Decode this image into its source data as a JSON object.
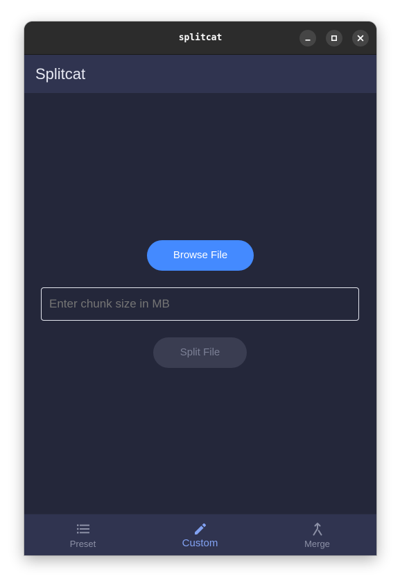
{
  "window": {
    "title": "splitcat",
    "controls": {
      "minimize_icon": "minimize-icon",
      "maximize_icon": "maximize-icon",
      "close_icon": "close-icon"
    }
  },
  "appbar": {
    "title": "Splitcat"
  },
  "main": {
    "browse_label": "Browse File",
    "chunk_input": {
      "value": "",
      "placeholder": "Enter chunk size in MB"
    },
    "split_label": "Split File"
  },
  "bottom_nav": {
    "items": [
      {
        "label": "Preset",
        "icon": "list-icon",
        "active": false
      },
      {
        "label": "Custom",
        "icon": "pencil-icon",
        "active": true
      },
      {
        "label": "Merge",
        "icon": "merge-icon",
        "active": false
      }
    ]
  },
  "colors": {
    "background": "#24273a",
    "appbar": "#303450",
    "accent": "#448aff",
    "active_nav": "#82a2f2",
    "inactive_nav": "#8c90a6",
    "disabled_button": "#3a3d51"
  }
}
